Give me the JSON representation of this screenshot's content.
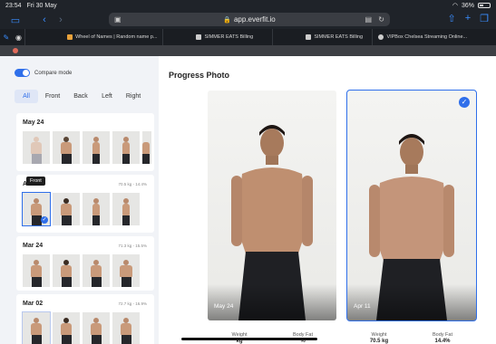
{
  "status": {
    "time": "23:54",
    "date": "Fri 30 May",
    "battery": "36%"
  },
  "browser": {
    "url": "app.everfit.io",
    "tabs": [
      {
        "title": "Wheel of Names | Random name p..."
      },
      {
        "title": "SIMMER EATS Billing"
      },
      {
        "title": "SIMMER EATS Billing"
      },
      {
        "title": "VIPBox Chelsea Streaming Online..."
      }
    ]
  },
  "sidebar": {
    "compare_label": "Compare mode",
    "filters": [
      "All",
      "Front",
      "Back",
      "Left",
      "Right"
    ],
    "tooltip": "Front",
    "groups": [
      {
        "date": "May 24",
        "stats": ""
      },
      {
        "date": "A",
        "stats": "70.5 kg - 14.4%"
      },
      {
        "date": "Mar 24",
        "stats": "71.3 kg - 15.5%"
      },
      {
        "date": "Mar 02",
        "stats": "72.7 kg - 16.9%"
      }
    ]
  },
  "main": {
    "title": "Progress Photo",
    "photo_left": {
      "label": "May 24",
      "weight_label": "Weight",
      "weight": "kg",
      "fat_label": "Body Fat",
      "fat": "%"
    },
    "photo_right": {
      "label": "Apr 11",
      "weight_label": "Weight",
      "weight": "70.5 kg",
      "fat_label": "Body Fat",
      "fat": "14.4%"
    }
  },
  "colors": {
    "accent": "#2f6fea"
  }
}
